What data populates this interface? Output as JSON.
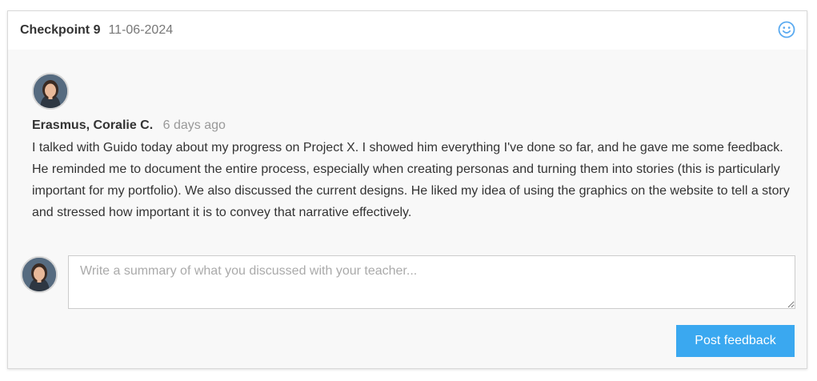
{
  "checkpoint": {
    "title": "Checkpoint 9",
    "date": "11-06-2024",
    "mood_icon": "smiley-face-icon"
  },
  "comment": {
    "author": "Erasmus, Coralie C.",
    "time_ago": "6 days ago",
    "body": "I talked with Guido today about my progress on Project X. I showed him everything I've done so far, and he gave me some feedback. He reminded me to document the entire process, especially when creating personas and turning them into stories (this is particularly important for my portfolio). We also discussed the current designs. He liked my idea of using the graphics on the website to tell a story and stressed how important it is to convey that narrative effectively."
  },
  "reply": {
    "placeholder": "Write a summary of what you discussed with your teacher...",
    "value": "",
    "submit_label": "Post feedback"
  },
  "colors": {
    "accent": "#3aa8f0",
    "icon": "#5aaaf0",
    "panel_bg": "#f8f8f8"
  }
}
